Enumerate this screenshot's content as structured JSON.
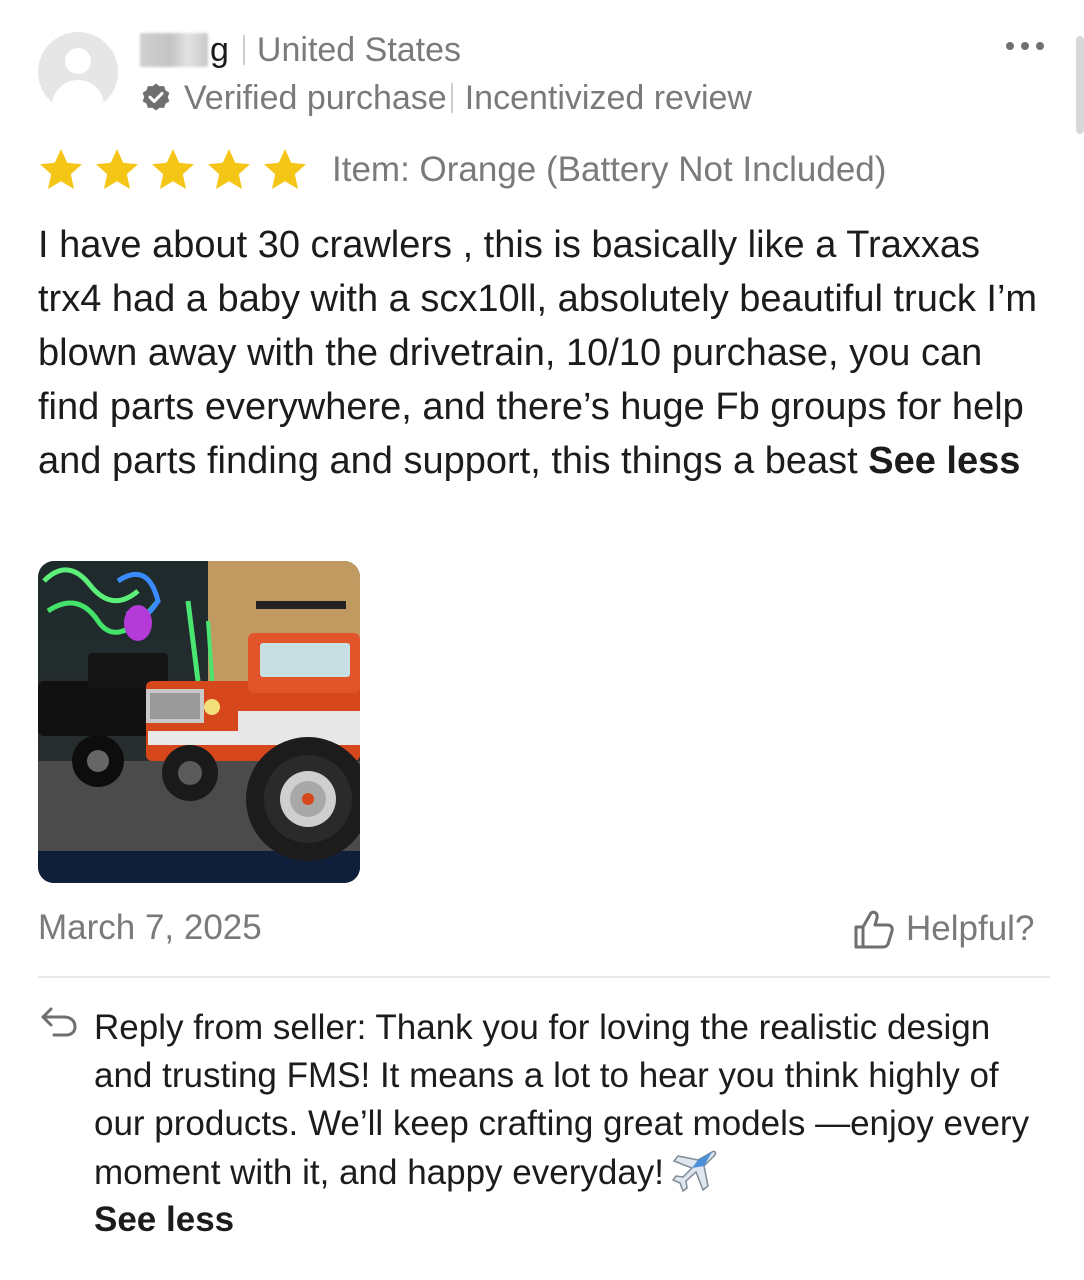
{
  "review": {
    "reviewer_name_suffix": "g",
    "country": "United States",
    "badges": [
      "Verified purchase",
      "Incentivized review"
    ],
    "rating": {
      "value": 5,
      "max": 5,
      "color": "#f5c518"
    },
    "item": "Item: Orange (Battery Not Included)",
    "text": "I have about 30 crawlers , this is basically like a Traxxas trx4 had a baby with a scx10ll, absolutely beautiful truck I’m blown away with the drivetrain, 10/10 purchase, you can find parts everywhere, and there’s huge Fb groups for help and parts finding and support, this things a beast",
    "see_less": "See less",
    "photo": {
      "subject": "orange-rc-crawler-truck"
    },
    "date": "March 7, 2025",
    "helpful_label": "Helpful?"
  },
  "seller_reply": {
    "text": "Reply from seller: Thank you for loving the realistic design and trusting FMS! It means a lot to hear you think highly of our products. We’ll keep crafting great models —enjoy every moment with it, and happy everyday!",
    "see_less": "See less"
  },
  "icons": {
    "avatar": "default-avatar-icon",
    "verified": "verified-badge-icon",
    "more": "more-options-icon",
    "star": "star-icon",
    "helpful": "thumbs-up-icon",
    "reply": "reply-arrow-icon",
    "emoji": "airplane-icon"
  }
}
